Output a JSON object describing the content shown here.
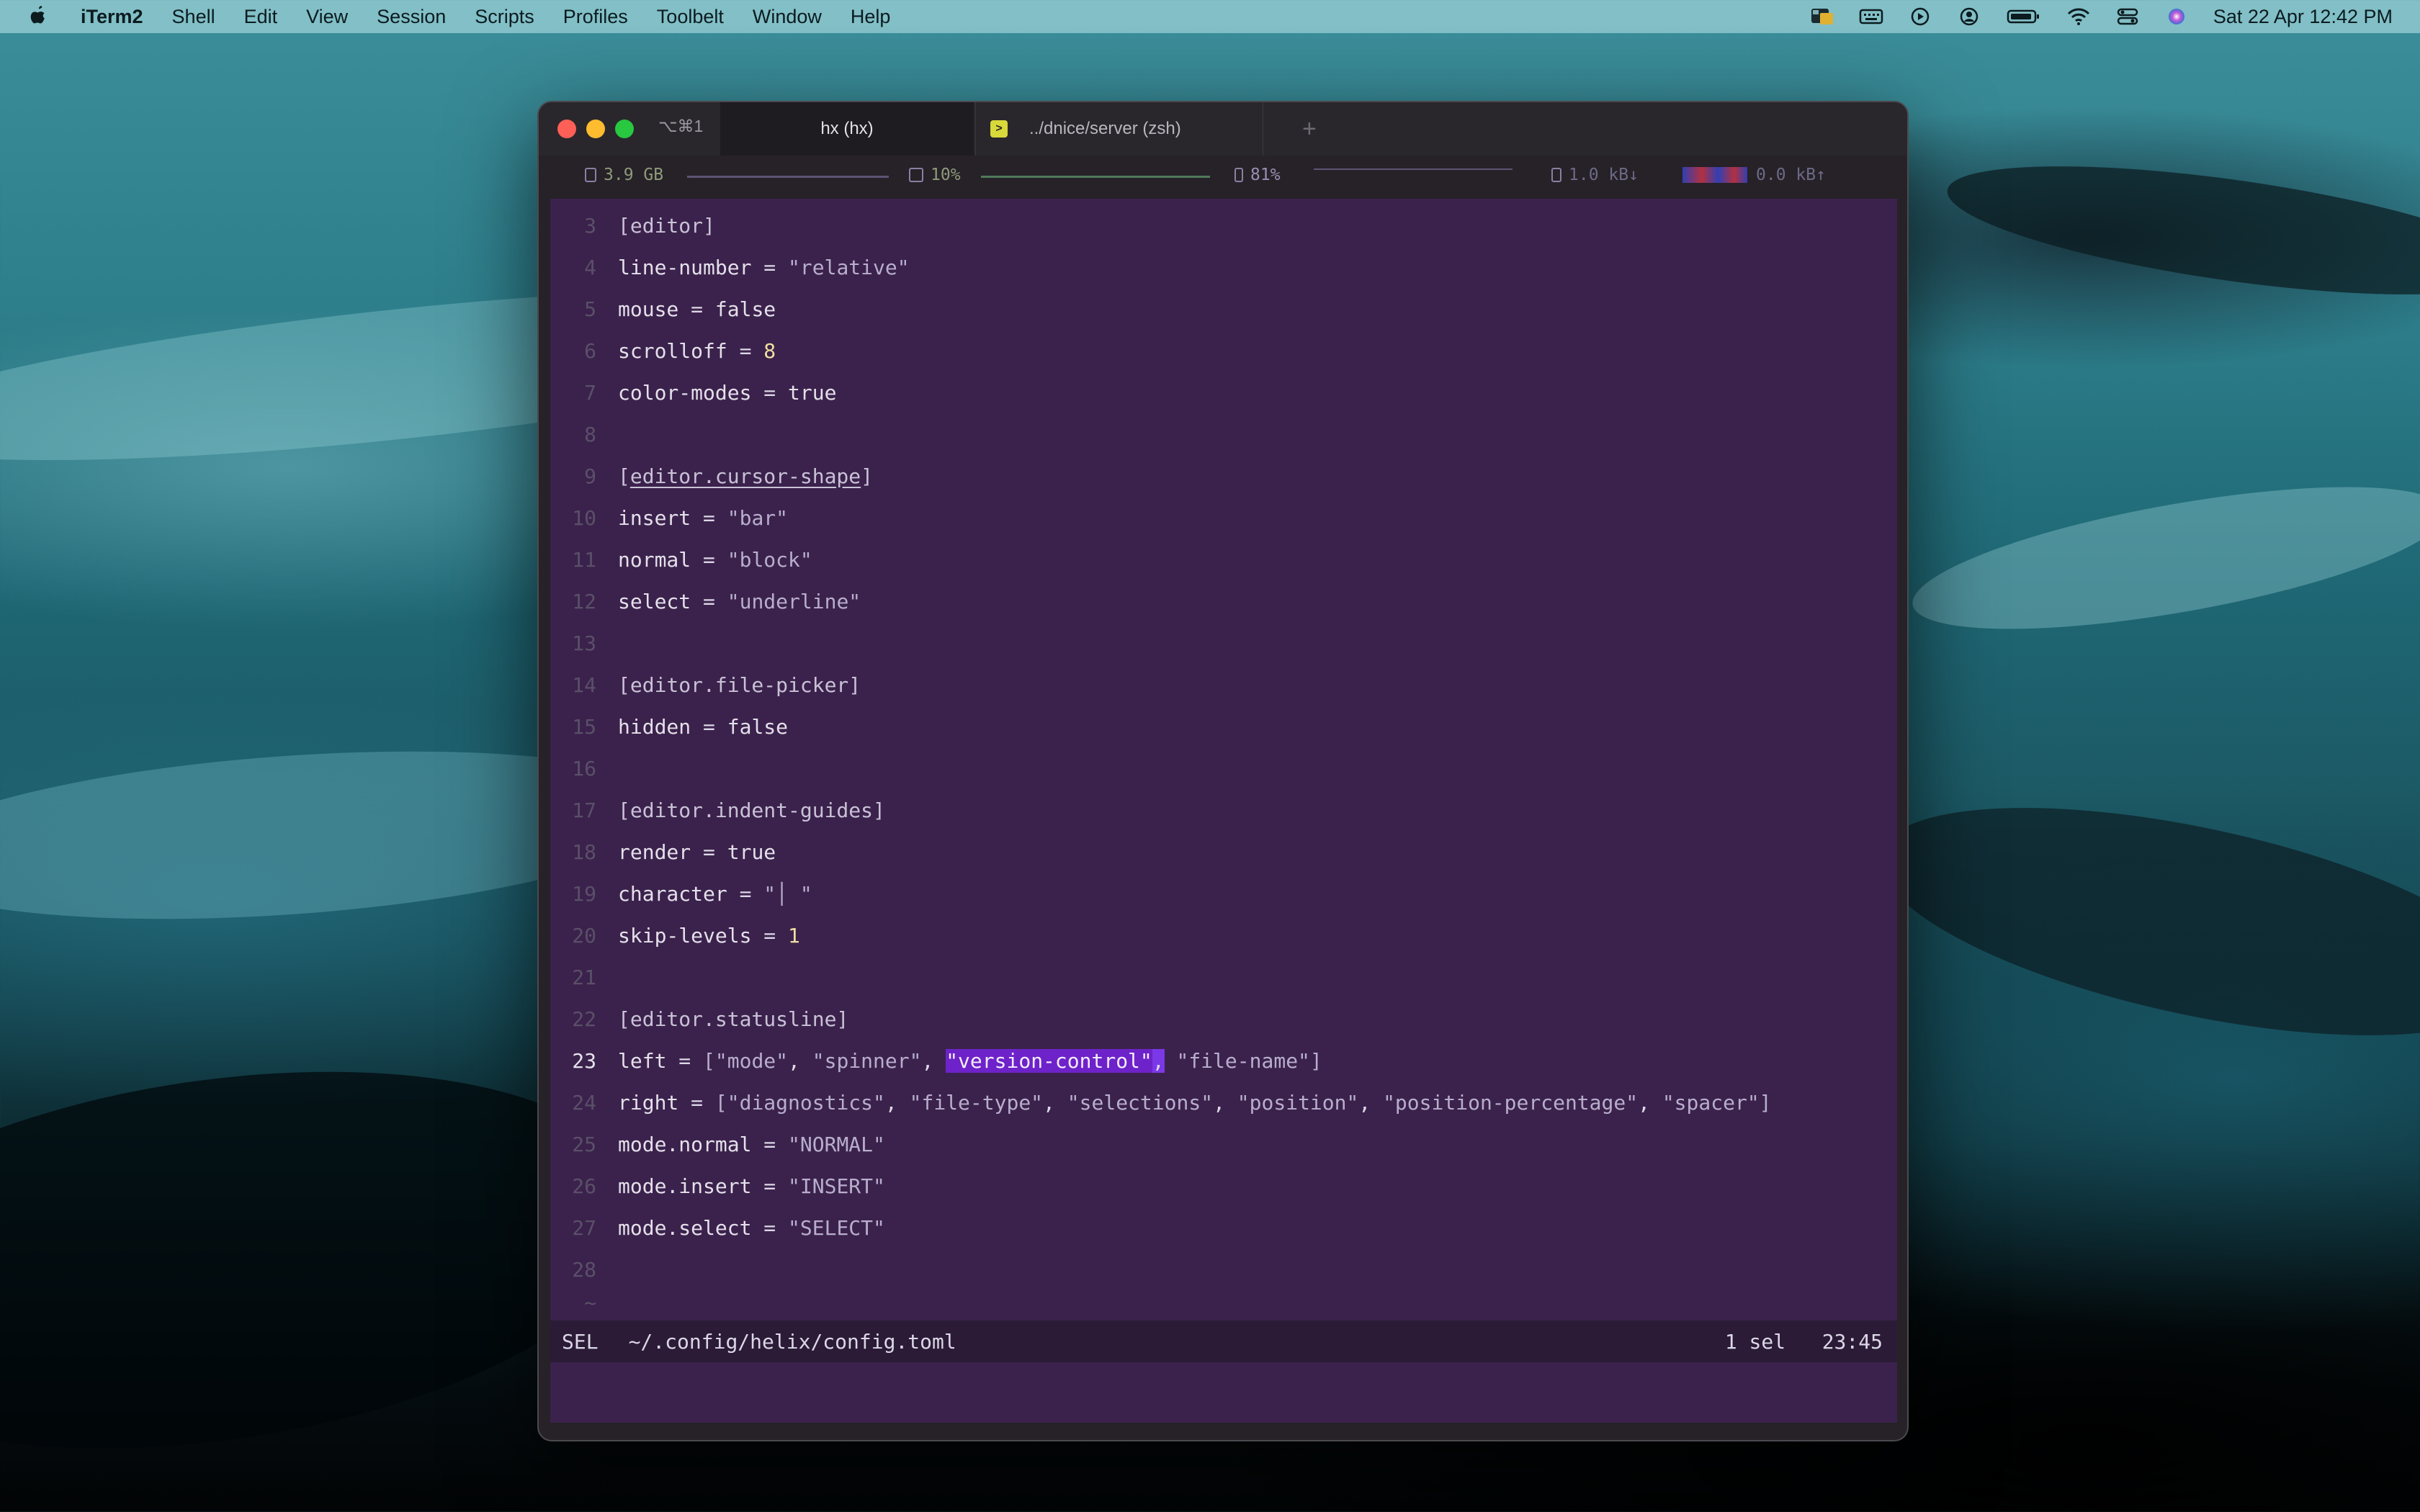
{
  "menubar": {
    "app_name": "iTerm2",
    "items": [
      "Shell",
      "Edit",
      "View",
      "Session",
      "Scripts",
      "Profiles",
      "Toolbelt",
      "Window",
      "Help"
    ],
    "datetime": "Sat 22 Apr  12:42 PM",
    "status_icons": [
      "finder-app-icon",
      "keyboard-icon",
      "play-icon",
      "user-icon",
      "battery-icon",
      "wifi-icon",
      "control-center-icon",
      "siri-icon"
    ]
  },
  "window": {
    "shortcut": "⌥⌘1",
    "tabs": [
      {
        "label": "hx (hx)",
        "active": true
      },
      {
        "label": "../dnice/server (zsh)",
        "active": false
      }
    ],
    "new_tab": "+"
  },
  "toolbelt": {
    "memory": "3.9 GB",
    "cpu": "10%",
    "battery": "81%",
    "net_down": "1.0 kB↓",
    "net_up": "0.0 kB↑"
  },
  "editor": {
    "lines": [
      {
        "num": "3",
        "text": "[editor]"
      },
      {
        "num": "4",
        "text": "line-number = \"relative\""
      },
      {
        "num": "5",
        "text": "mouse = false"
      },
      {
        "num": "6",
        "text": "scrolloff = 8"
      },
      {
        "num": "7",
        "text": "color-modes = true"
      },
      {
        "num": "8",
        "text": ""
      },
      {
        "num": "9",
        "text": "[editor.cursor-shape]"
      },
      {
        "num": "10",
        "text": "insert = \"bar\""
      },
      {
        "num": "11",
        "text": "normal = \"block\""
      },
      {
        "num": "12",
        "text": "select = \"underline\""
      },
      {
        "num": "13",
        "text": ""
      },
      {
        "num": "14",
        "text": "[editor.file-picker]"
      },
      {
        "num": "15",
        "text": "hidden = false"
      },
      {
        "num": "16",
        "text": ""
      },
      {
        "num": "17",
        "text": "[editor.indent-guides]"
      },
      {
        "num": "18",
        "text": "render = true"
      },
      {
        "num": "19",
        "text": "character = \"│\""
      },
      {
        "num": "20",
        "text": "skip-levels = 1"
      },
      {
        "num": "21",
        "text": ""
      },
      {
        "num": "22",
        "text": "[editor.statusline]"
      },
      {
        "num": "23",
        "text": "left = [\"mode\", \"spinner\", \"version-control\", \"file-name\"]"
      },
      {
        "num": "24",
        "text": "right = [\"diagnostics\", \"file-type\", \"selections\", \"position\", \"position-percentage\", \"spacer\"]"
      },
      {
        "num": "25",
        "text": "mode.normal = \"NORMAL\""
      },
      {
        "num": "26",
        "text": "mode.insert = \"INSERT\""
      },
      {
        "num": "27",
        "text": "mode.select = \"SELECT\""
      },
      {
        "num": "28",
        "text": ""
      }
    ],
    "tilde": "~",
    "current_line": "23",
    "selection_text": "\"version-control\""
  },
  "statusline": {
    "mode": "SEL",
    "file": "~/.config/helix/config.toml",
    "selections": "1 sel",
    "position": "23:45"
  },
  "colors": {
    "editor_bg": "#3b224c",
    "statusline_bg": "#2b1b37",
    "selection": "#6e22c9",
    "number": "#f0dfa0"
  }
}
